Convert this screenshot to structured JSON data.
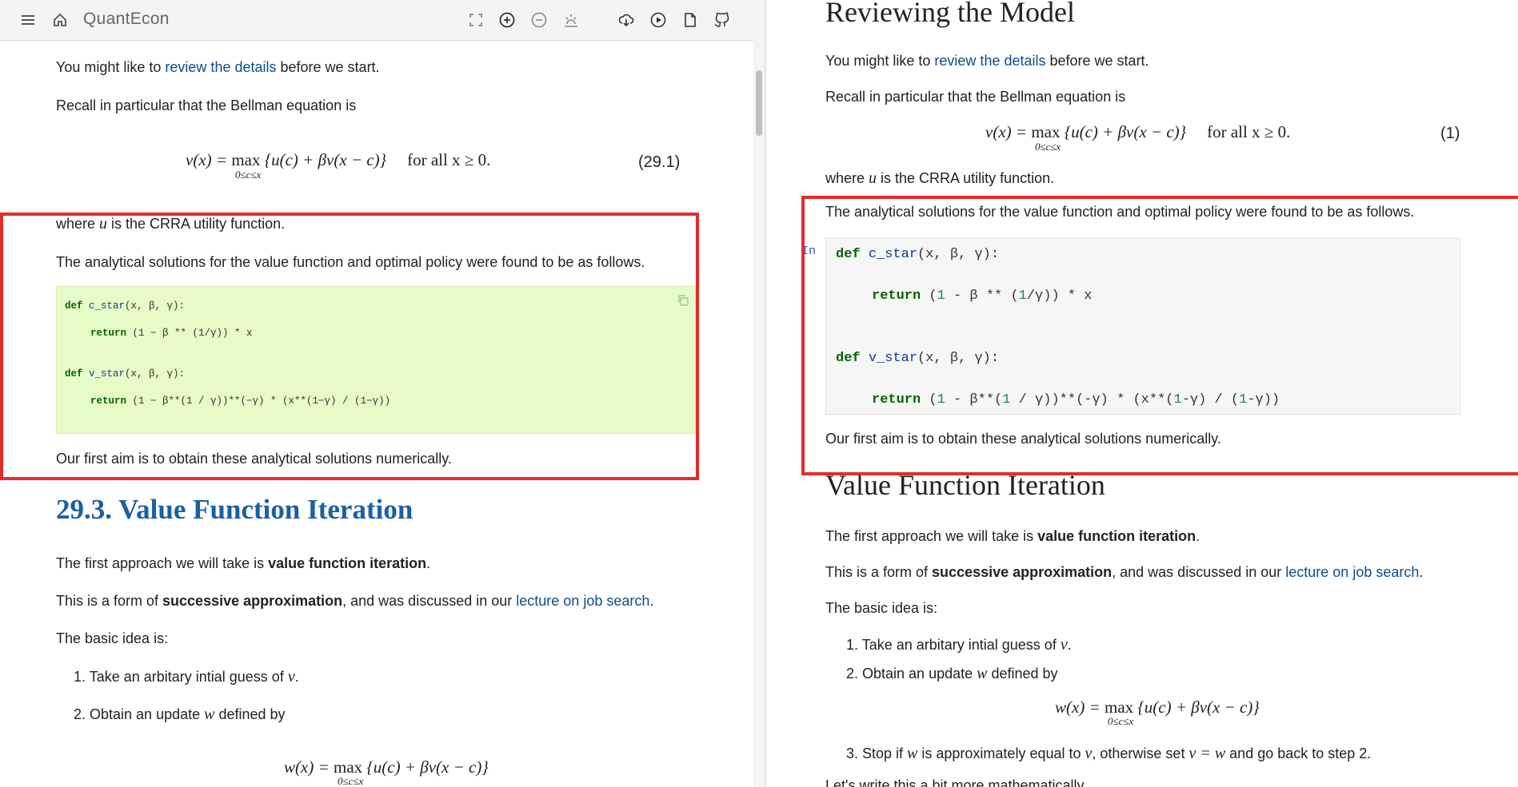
{
  "colors": {
    "accent_heading": "#1a5fa6",
    "link": "#0b4d8c",
    "highlight_box": "#e62b2b",
    "code_left_bg": "#e6fbc8",
    "code_right_bg": "#f6f6f6"
  },
  "left": {
    "toolbar": {
      "brand": "QuantEcon",
      "icons": [
        "menu-icon",
        "home-icon",
        "fullscreen-icon",
        "zoom-in-icon",
        "zoom-out-icon",
        "theme-icon",
        "download-icon",
        "play-icon",
        "file-icon",
        "github-icon"
      ]
    },
    "p_review": {
      "before": "You might like to ",
      "link": "review the details",
      "after": " before we start."
    },
    "p_recall": "Recall in particular that the Bellman equation is",
    "eq1": {
      "lhs": "v(x) = ",
      "op": "max",
      "body": "{u(c) + βv(x − c)}",
      "cond": "for all x ≥ 0.",
      "under": "0≤c≤x",
      "num": "(29.1)"
    },
    "p_where": {
      "before": "where ",
      "var": "u",
      "after": " is the CRRA utility function."
    },
    "p_analytical": "The analytical solutions for the value function and optimal policy were found to be as follows.",
    "code": {
      "l1_kw": "def",
      "l1_fn": "c_star",
      "l1_rest": "(x, β, γ):",
      "l2_kw": "return",
      "l2_rest": " (1 − β ** (1/γ)) * x",
      "l3_kw": "def",
      "l3_fn": "v_star",
      "l3_rest": "(x, β, γ):",
      "l4_kw": "return",
      "l4_rest": " (1 − β**(1 / γ))**(−γ) * (x**(1−γ) / (1−γ))"
    },
    "p_aim": "Our first aim is to obtain these analytical solutions numerically.",
    "heading": "29.3. Value Function Iteration",
    "p_first": {
      "before": "The first approach we will take is ",
      "bold": "value function iteration",
      "after": "."
    },
    "p_form": {
      "before": "This is a form of ",
      "bold": "successive approximation",
      "mid": ", and was discussed in our ",
      "link": "lecture on job search",
      "after": "."
    },
    "p_basic": "The basic idea is:",
    "li1": {
      "before": "1. Take an arbitary intial guess of ",
      "var": "v",
      "after": "."
    },
    "li2": {
      "before": "2. Obtain an update ",
      "var": "w",
      "after": " defined by"
    },
    "eq2": {
      "lhs": "w(x) = ",
      "op": "max",
      "body": "{u(c) + βv(x − c)}",
      "under": "0≤c≤x"
    }
  },
  "right": {
    "title": "Reviewing the Model",
    "p_review": {
      "before": "You might like to ",
      "link": "review the details",
      "after": " before we start."
    },
    "p_recall": "Recall in particular that the Bellman equation is",
    "eq1": {
      "lhs": "v(x) = ",
      "op": "max",
      "body": "{u(c) + βv(x − c)}",
      "cond": "for all x ≥ 0.",
      "under": "0≤c≤x",
      "num": "(1)"
    },
    "p_where": {
      "before": "where ",
      "var": "u",
      "after": " is the CRRA utility function."
    },
    "p_analytical": "The analytical solutions for the value function and optimal policy were found to be as follows.",
    "prompt": "In",
    "code": {
      "l1_kw": "def",
      "l1_fn": "c_star",
      "l1_rest": "(x, β, γ):",
      "l2_kw": "return",
      "l2_a": " (",
      "l2_n1": "1",
      "l2_b": " - β ** (",
      "l2_n2": "1",
      "l2_c": "/γ)) * x",
      "l3_kw": "def",
      "l3_fn": "v_star",
      "l3_rest": "(x, β, γ):",
      "l4_kw": "return",
      "l4_a": " (",
      "l4_n1": "1",
      "l4_b": " - β**(",
      "l4_n2": "1",
      "l4_c": " / γ))**(-γ) * (x**(",
      "l4_n3": "1",
      "l4_d": "-γ) / (",
      "l4_n4": "1",
      "l4_e": "-γ))"
    },
    "p_aim": "Our first aim is to obtain these analytical solutions numerically.",
    "heading": "Value Function Iteration",
    "p_first": {
      "before": "The first approach we will take is ",
      "bold": "value function iteration",
      "after": "."
    },
    "p_form": {
      "before": "This is a form of ",
      "bold": "successive approximation",
      "mid": ", and was discussed in our ",
      "link": "lecture on job search",
      "after": "."
    },
    "p_basic": "The basic idea is:",
    "li1": {
      "before": "1. Take an arbitary intial guess of ",
      "var": "v",
      "after": "."
    },
    "li2": {
      "before": "2. Obtain an update ",
      "var": "w",
      "after": " defined by"
    },
    "eq2": {
      "lhs": "w(x) = ",
      "op": "max",
      "body": "{u(c) + βv(x − c)}",
      "under": "0≤c≤x"
    },
    "li3": {
      "before": "3. Stop if ",
      "var1": "w",
      "mid1": " is approximately equal to ",
      "var2": "v",
      "mid2": ", otherwise set ",
      "eq": "v = w",
      "after": " and go back to step 2."
    },
    "p_cut": "Let's write this a bit more mathematically."
  }
}
